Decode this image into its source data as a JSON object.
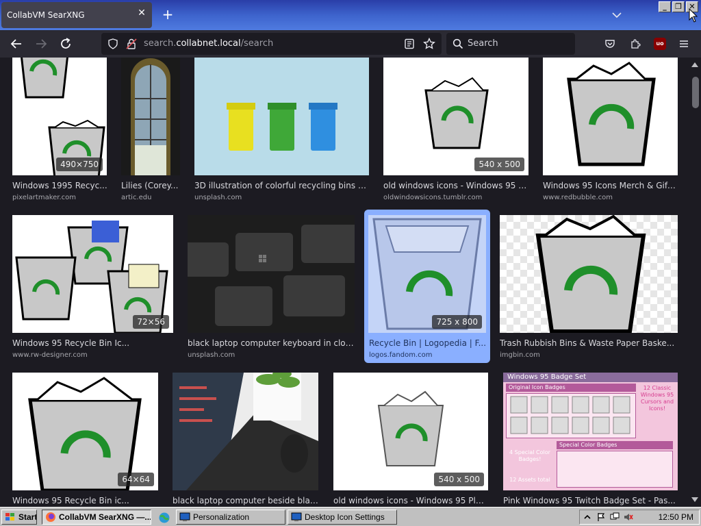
{
  "browser": {
    "tab_title": "CollabVM SearXNG",
    "url_prefix": "search.",
    "url_host": "collabnet.local",
    "url_path": "/search",
    "search_placeholder": "Search",
    "extension_badge": "uo"
  },
  "results": [
    {
      "title": "Windows 1995 Recyc...",
      "source": "pixelartmaker.com",
      "resolution": "490×750"
    },
    {
      "title": "Lilies (Corey...",
      "source": "artic.edu",
      "resolution": ""
    },
    {
      "title": "3D illustration of colorful recycling bins for...",
      "source": "unsplash.com",
      "resolution": ""
    },
    {
      "title": "old windows icons - Windows 95 - ...",
      "source": "oldwindowsicons.tumblr.com",
      "resolution": "540 x 500"
    },
    {
      "title": "Windows 95 Icons Merch & Gift...",
      "source": "www.redbubble.com",
      "resolution": ""
    },
    {
      "title": "Windows 95 Recycle Bin Ic...",
      "source": "www.rw-designer.com",
      "resolution": "72×56"
    },
    {
      "title": "black laptop computer keyboard in clos...",
      "source": "unsplash.com",
      "resolution": ""
    },
    {
      "title": "Recycle Bin | Logopedia | F...",
      "source": "logos.fandom.com",
      "resolution": "725 x 800"
    },
    {
      "title": "Trash Rubbish Bins & Waste Paper Baske...",
      "source": "imgbin.com",
      "resolution": ""
    },
    {
      "title": "Windows 95 Recycle Bin ic...",
      "source": "",
      "resolution": "64×64"
    },
    {
      "title": "black laptop computer beside blac...",
      "source": "",
      "resolution": ""
    },
    {
      "title": "old windows icons - Windows 95 Plu...",
      "source": "",
      "resolution": "540 x 500"
    },
    {
      "title": "Pink Windows 95 Twitch Badge Set - Pas...",
      "source": "",
      "resolution": ""
    }
  ],
  "badge_image_text": {
    "header": "Windows 95 Badge Set",
    "section1": "Original Icon Badges",
    "section2": "Special Color Badges",
    "note1": "12 Classic Windows 95 Cursors and Icons!",
    "note2": "4 Special Color Badges!",
    "note3": "12 Assets total"
  },
  "taskbar": {
    "start_label": "Start",
    "items": [
      "CollabVM SearXNG —...",
      "Personalization",
      "Desktop Icon Settings"
    ],
    "clock": "12:50 PM"
  },
  "colors": {
    "accent": "#8aafff",
    "recycle_green": "#1f8f2a",
    "taskbar": "#c0c0c0"
  }
}
